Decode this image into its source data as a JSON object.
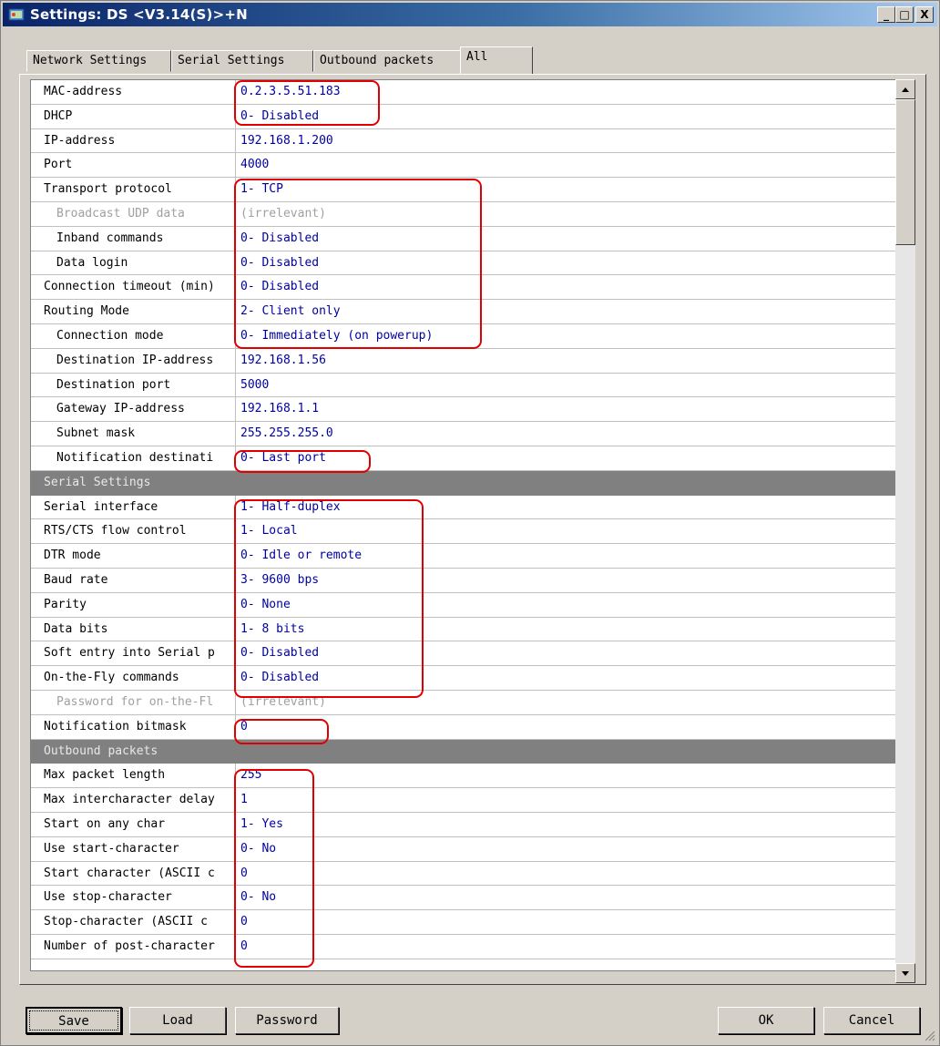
{
  "window": {
    "title": "Settings: DS <V3.14(S)>+N"
  },
  "title_buttons": {
    "minimize": "_",
    "maximize": "□",
    "close": "X"
  },
  "tabs": [
    "Network Settings",
    "Serial Settings",
    "Outbound packets",
    "All"
  ],
  "rows": [
    {
      "label": "MAC-address",
      "value": "0.2.3.5.51.183"
    },
    {
      "label": "DHCP",
      "value": "0- Disabled"
    },
    {
      "label": "IP-address",
      "value": "192.168.1.200"
    },
    {
      "label": "Port",
      "value": "4000"
    },
    {
      "label": "Transport protocol",
      "value": "1- TCP"
    },
    {
      "label": "Broadcast UDP data",
      "value": "(irrelevant)"
    },
    {
      "label": "Inband commands",
      "value": "0- Disabled"
    },
    {
      "label": "Data login",
      "value": "0- Disabled"
    },
    {
      "label": "Connection timeout (min)",
      "value": "0- Disabled"
    },
    {
      "label": "Routing Mode",
      "value": "2- Client only"
    },
    {
      "label": "Connection mode",
      "value": "0- Immediately (on powerup)"
    },
    {
      "label": "Destination IP-address",
      "value": "192.168.1.56"
    },
    {
      "label": "Destination port",
      "value": "5000"
    },
    {
      "label": "Gateway IP-address",
      "value": "192.168.1.1"
    },
    {
      "label": "Subnet mask",
      "value": "255.255.255.0"
    },
    {
      "label": "Notification destinati",
      "value": "0- Last port"
    },
    {
      "label": "Serial Settings",
      "value": ""
    },
    {
      "label": "Serial interface",
      "value": "1- Half-duplex"
    },
    {
      "label": "RTS/CTS flow control",
      "value": "1- Local"
    },
    {
      "label": "DTR mode",
      "value": "0- Idle or remote"
    },
    {
      "label": "Baud rate",
      "value": "3- 9600 bps"
    },
    {
      "label": "Parity",
      "value": "0- None"
    },
    {
      "label": "Data bits",
      "value": "1- 8 bits"
    },
    {
      "label": "Soft entry into Serial p",
      "value": "0- Disabled"
    },
    {
      "label": "On-the-Fly commands",
      "value": "0- Disabled"
    },
    {
      "label": "Password for on-the-Fl",
      "value": "(irrelevant)"
    },
    {
      "label": "Notification bitmask",
      "value": "0"
    },
    {
      "label": "Outbound packets",
      "value": ""
    },
    {
      "label": "Max packet length",
      "value": "255"
    },
    {
      "label": "Max intercharacter delay",
      "value": "1"
    },
    {
      "label": "Start on any char",
      "value": "1- Yes"
    },
    {
      "label": "Use start-character",
      "value": "0- No"
    },
    {
      "label": "Start character (ASCII c",
      "value": "0"
    },
    {
      "label": "Use stop-character",
      "value": "0- No"
    },
    {
      "label": "Stop-character (ASCII c",
      "value": "0"
    },
    {
      "label": "Number of post-character",
      "value": "0"
    }
  ],
  "buttons": {
    "save": "Save",
    "load": "Load",
    "password": "Password",
    "ok": "OK",
    "cancel": "Cancel"
  },
  "colors": {
    "titlebar": "#0a246a",
    "value_text": "#0000a0",
    "section_header": "#808080",
    "highlight": "#e00000"
  }
}
